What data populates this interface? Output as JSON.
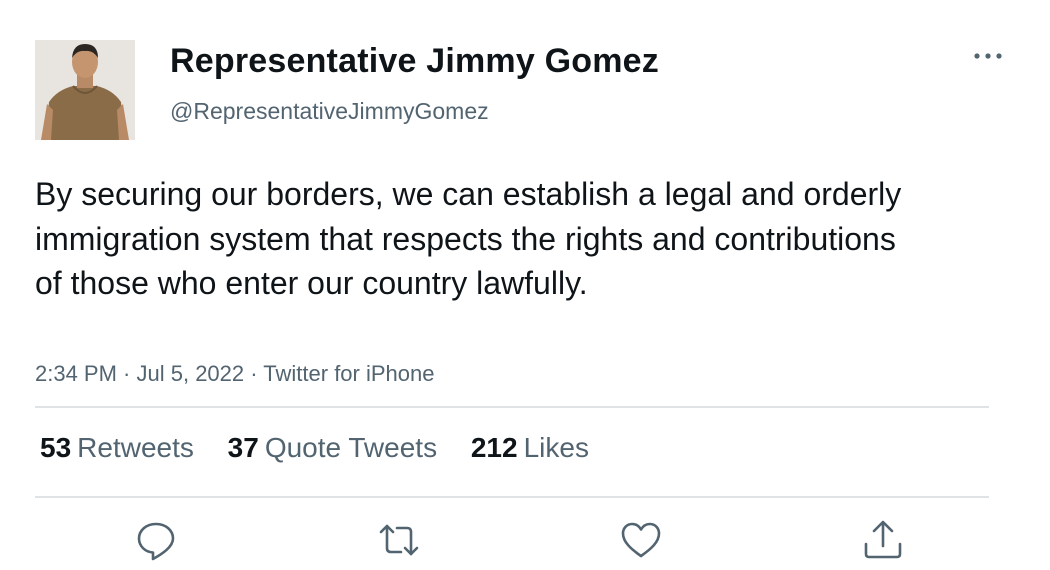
{
  "author": {
    "display_name": "Representative Jimmy Gomez",
    "handle": "@RepresentativeJimmyGomez",
    "avatar_icon": "profile-photo"
  },
  "tweet": {
    "text": "By securing our borders, we can establish a legal and orderly immigration system that respects the rights and contributions of those who enter our country lawfully.",
    "time": "2:34 PM",
    "separator": " · ",
    "date": "Jul 5, 2022",
    "source": "Twitter for iPhone"
  },
  "stats": {
    "retweets_count": "53",
    "retweets_label": "Retweets",
    "quotes_count": "37",
    "quotes_label": "Quote Tweets",
    "likes_count": "212",
    "likes_label": "Likes"
  },
  "actions": [
    "reply-icon",
    "retweet-icon",
    "like-icon",
    "share-icon"
  ],
  "colors": {
    "text_primary": "#0f1419",
    "text_secondary": "#536471",
    "divider": "#dfe3e6",
    "icon": "#536471"
  }
}
